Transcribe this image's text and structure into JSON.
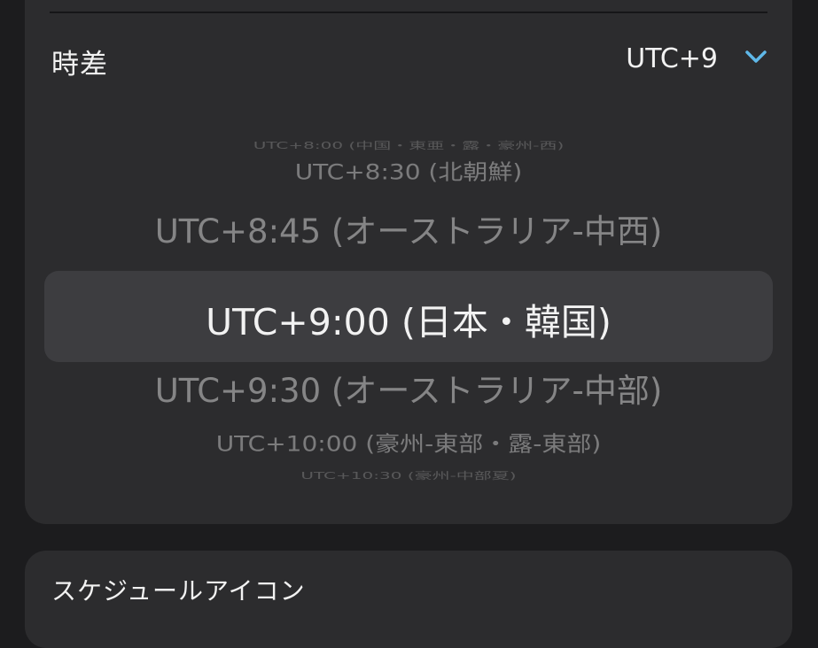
{
  "timezone_section": {
    "label": "時差",
    "selected_value": "UTC+9",
    "accent_color": "#5fb8e8",
    "icon": "chevron-down-icon",
    "picker_options": [
      "UTC+8:00 (中国・東亜・露・豪州-西)",
      "UTC+8:30 (北朝鮮)",
      "UTC+8:45 (オーストラリア-中西)",
      "UTC+9:00 (日本・韓国)",
      "UTC+9:30 (オーストラリア-中部)",
      "UTC+10:00 (豪州-東部・露-東部)",
      "UTC+10:30 (豪州-中部夏)"
    ],
    "selected_index": 3
  },
  "schedule_icon_section": {
    "label": "スケジュールアイコン"
  }
}
